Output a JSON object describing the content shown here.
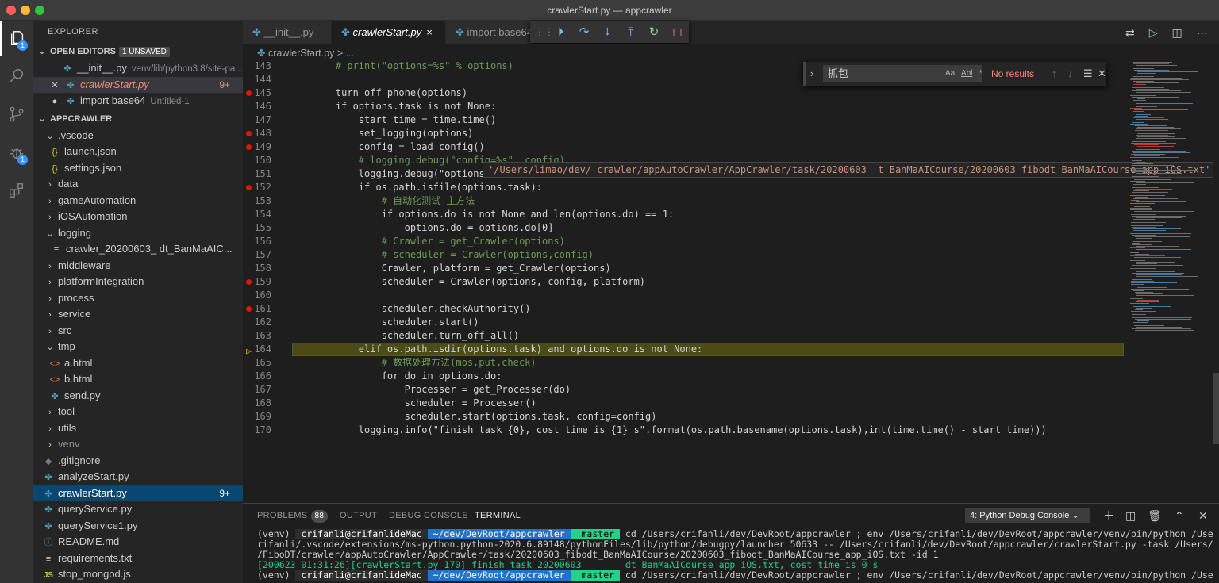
{
  "window": {
    "title": "crawlerStart.py — appcrawler"
  },
  "activity": {
    "explorer_badge": "1",
    "debug_badge": "1"
  },
  "sidebar": {
    "title": "EXPLORER",
    "open_editors": {
      "label": "OPEN EDITORS",
      "unsaved": "1 UNSAVED",
      "items": [
        {
          "name": "__init__.py",
          "desc": "venv/lib/python3.8/site-pa..."
        },
        {
          "name": "crawlerStart.py",
          "desc": "",
          "errors": "9+"
        },
        {
          "name": "import base64",
          "desc": "Untitled-1"
        }
      ]
    },
    "project": {
      "label": "APPCRAWLER",
      "items": [
        {
          "label": ".vscode"
        },
        {
          "label": "launch.json"
        },
        {
          "label": "settings.json"
        },
        {
          "label": "data"
        },
        {
          "label": "gameAutomation"
        },
        {
          "label": "iOSAutomation"
        },
        {
          "label": "logging"
        },
        {
          "label": "crawler_20200603_       dt_BanMaAIC..."
        },
        {
          "label": "middleware"
        },
        {
          "label": "platformIntegration"
        },
        {
          "label": "process"
        },
        {
          "label": "service"
        },
        {
          "label": "src"
        },
        {
          "label": "tmp"
        },
        {
          "label": "a.html"
        },
        {
          "label": "b.html"
        },
        {
          "label": "send.py"
        },
        {
          "label": "tool"
        },
        {
          "label": "utils"
        },
        {
          "label": "venv"
        },
        {
          "label": ".gitignore"
        },
        {
          "label": "analyzeStart.py"
        },
        {
          "label": "crawlerStart.py",
          "errors": "9+"
        },
        {
          "label": "queryService.py"
        },
        {
          "label": "queryService1.py"
        },
        {
          "label": "README.md"
        },
        {
          "label": "requirements.txt"
        },
        {
          "label": "stop_mongod.js"
        }
      ]
    }
  },
  "tabs": [
    {
      "label": "__init__.py"
    },
    {
      "label": "crawlerStart.py",
      "close": "×"
    },
    {
      "label": "import base64"
    }
  ],
  "breadcrumb": {
    "file": "crawlerStart.py",
    "rest": "> ..."
  },
  "find": {
    "query": "抓包",
    "case": "Aa",
    "word": "Abl",
    "regex": ".*",
    "result": "No results"
  },
  "hover": {
    "text": "'/Users/limao/dev/          crawler/appAutoCrawler/AppCrawler/task/20200603_        t_BanMaAICourse/20200603_fibodt_BanMaAICourse_app_iOS.txt'"
  },
  "code": {
    "lines": [
      {
        "n": "143",
        "t": "    # print(\"options=%s\" % options)"
      },
      {
        "n": "144",
        "t": ""
      },
      {
        "n": "145",
        "t": "    turn_off_phone(options)"
      },
      {
        "n": "146",
        "t": "    if options.task is not None:"
      },
      {
        "n": "147",
        "t": "        start_time = time.time()"
      },
      {
        "n": "148",
        "t": "        set_logging(options)"
      },
      {
        "n": "149",
        "t": "        config = load_config()"
      },
      {
        "n": "150",
        "t": "        # logging.debug(\"config=%s\", config)"
      },
      {
        "n": "151",
        "t": "        logging.debug(\"options.task="
      },
      {
        "n": "152",
        "t": "        if os.path.isfile(options.task):"
      },
      {
        "n": "153",
        "t": "            # 自动化测试 主方法"
      },
      {
        "n": "154",
        "t": "            if options.do is not None and len(options.do) == 1:"
      },
      {
        "n": "155",
        "t": "                options.do = options.do[0]"
      },
      {
        "n": "156",
        "t": "            # Crawler = get_Crawler(options)"
      },
      {
        "n": "157",
        "t": "            # scheduler = Crawler(options,config)"
      },
      {
        "n": "158",
        "t": "            Crawler, platform = get_Crawler(options)"
      },
      {
        "n": "159",
        "t": "            scheduler = Crawler(options, config, platform)"
      },
      {
        "n": "160",
        "t": ""
      },
      {
        "n": "161",
        "t": "            scheduler.checkAuthority()"
      },
      {
        "n": "162",
        "t": "            scheduler.start()"
      },
      {
        "n": "163",
        "t": "            scheduler.turn_off_all()"
      },
      {
        "n": "164",
        "t": "        elif os.path.isdir(options.task) and options.do is not None:"
      },
      {
        "n": "165",
        "t": "            # 数据处理方法(mos,put,check)"
      },
      {
        "n": "166",
        "t": "            for do in options.do:"
      },
      {
        "n": "167",
        "t": "                Processer = get_Processer(do)"
      },
      {
        "n": "168",
        "t": "                scheduler = Processer()"
      },
      {
        "n": "169",
        "t": "                scheduler.start(options.task, config=config)"
      },
      {
        "n": "170",
        "t": "        logging.info(\"finish task {0}, cost time is {1} s\".format(os.path.basename(options.task),int(time.time() - start_time)))"
      }
    ]
  },
  "panel": {
    "tabs": {
      "problems": "PROBLEMS",
      "problems_count": "88",
      "output": "OUTPUT",
      "debug": "DEBUG CONSOLE",
      "terminal": "TERMINAL"
    },
    "terminal_select": "4: Python Debug Console",
    "terminal": {
      "l1_venv": "(venv) ",
      "l1_user": " crifanli@crifanlideMac ",
      "l1_path": " ~/dev/DevRoot/appcrawler ",
      "l1_git": "  master ",
      "l1_cmd": " cd /Users/crifanli/dev/DevRoot/appcrawler ; env /Users/crifanli/dev/DevRoot/appcrawler/venv/bin/python /Users/c",
      "l2": "rifanli/.vscode/extensions/ms-python.python-2020.6.89148/pythonFiles/lib/python/debugpy/launcher 50633 -- /Users/crifanli/dev/DevRoot/appcrawler/crawlerStart.py -task /Users/limao/dev",
      "l3": "/FiboDT/crawler/appAutoCrawler/AppCrawler/task/20200603_fibodt_BanMaAICourse/20200603_fibodt_BanMaAICourse_app_iOS.txt -id 1",
      "l4": "[200623 01:31:26][crawlerStart.py 170] finish task 20200603_       dt_BanMaAICourse_app_iOS.txt, cost time is 0 s",
      "l5_cmd": " cd /Users/crifanli/dev/DevRoot/appcrawler ; env /Users/crifanli/dev/DevRoot/appcrawler/venv/bin/python /Users/c"
    }
  }
}
